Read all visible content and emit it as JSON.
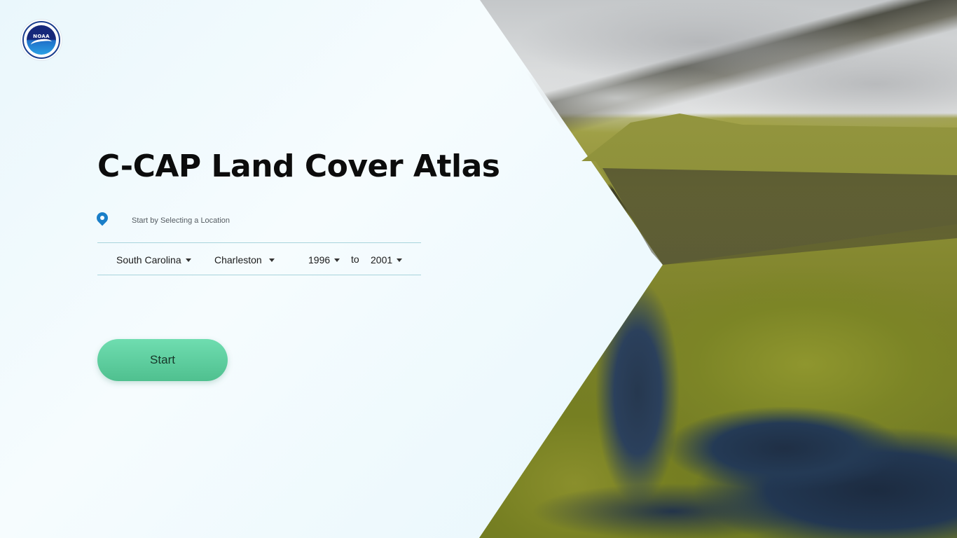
{
  "app": {
    "title": "C-CAP Land Cover Atlas",
    "logo_text": "NOAA"
  },
  "location": {
    "icon": "map-pin-icon",
    "hint": "Start by Selecting a Location"
  },
  "selectors": {
    "state": "South Carolina",
    "county": "Charleston",
    "year_from": "1996",
    "to_label": "to",
    "year_to": "2001"
  },
  "actions": {
    "start_label": "Start"
  },
  "colors": {
    "accent_green": "#5fd1a0",
    "pin_blue": "#1a7ec8",
    "divider": "#a8d4dc"
  }
}
